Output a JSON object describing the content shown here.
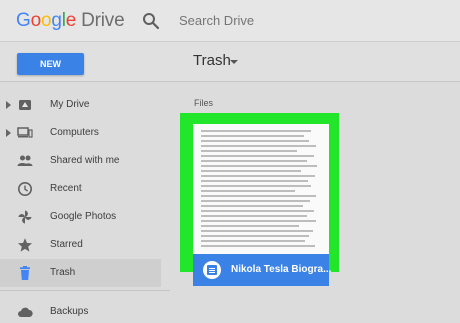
{
  "header": {
    "logo_google": [
      "G",
      "o",
      "o",
      "g",
      "l",
      "e"
    ],
    "logo_product": "Drive",
    "search_placeholder": "Search Drive"
  },
  "toolbar": {
    "new_label": "NEW",
    "breadcrumb": "Trash"
  },
  "sidebar": {
    "items": [
      {
        "label": "My Drive",
        "icon": "drive-icon",
        "expandable": true
      },
      {
        "label": "Computers",
        "icon": "computers-icon",
        "expandable": true
      },
      {
        "label": "Shared with me",
        "icon": "people-icon",
        "expandable": false
      },
      {
        "label": "Recent",
        "icon": "clock-icon",
        "expandable": false
      },
      {
        "label": "Google Photos",
        "icon": "photos-pinwheel-icon",
        "expandable": false
      },
      {
        "label": "Starred",
        "icon": "star-icon",
        "expandable": false
      },
      {
        "label": "Trash",
        "icon": "trash-icon",
        "expandable": false,
        "active": true
      },
      {
        "label": "Backups",
        "icon": "cloud-icon",
        "expandable": false
      }
    ]
  },
  "main": {
    "section_label": "Files",
    "files": [
      {
        "name": "Nikola Tesla Biogra...",
        "type_icon": "google-docs-icon"
      }
    ]
  },
  "colors": {
    "accent": "#3b82e6",
    "highlight": "#22e62a",
    "trash_icon": "#4285f4"
  }
}
